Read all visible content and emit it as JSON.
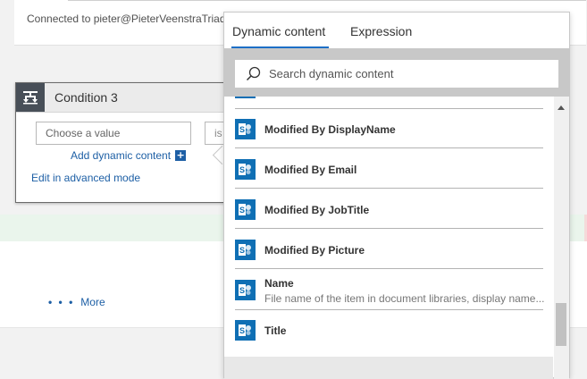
{
  "connection": {
    "text": "Connected to pieter@PieterVeenstraTriad"
  },
  "condition": {
    "title": "Condition 3",
    "value_placeholder": "Choose a value",
    "operator_partial": "is",
    "add_dynamic_label": "Add dynamic content",
    "advanced_mode_label": "Edit in advanced mode"
  },
  "more": {
    "dots": "• • •",
    "label": "More"
  },
  "flyout": {
    "tabs": [
      {
        "label": "Dynamic content",
        "active": true
      },
      {
        "label": "Expression",
        "active": false
      }
    ],
    "search_placeholder": "Search dynamic content",
    "items": [
      {
        "label": "Modified By DisplayName",
        "description": ""
      },
      {
        "label": "Modified By Email",
        "description": ""
      },
      {
        "label": "Modified By JobTitle",
        "description": ""
      },
      {
        "label": "Modified By Picture",
        "description": ""
      },
      {
        "label": "Name",
        "description": "File name of the item in document libraries, display name..."
      },
      {
        "label": "Title",
        "description": ""
      }
    ]
  },
  "colors": {
    "accent": "#1d6fc6",
    "link": "#1d5fa5",
    "sharepoint_icon": "#0f6fb4",
    "condition_icon_bg": "#484f58"
  },
  "icons": {
    "condition": "condition-icon",
    "search": "search-icon",
    "sharepoint": "sharepoint-icon",
    "plus": "plus-icon",
    "scroll_up": "scroll-up-arrow-icon"
  }
}
